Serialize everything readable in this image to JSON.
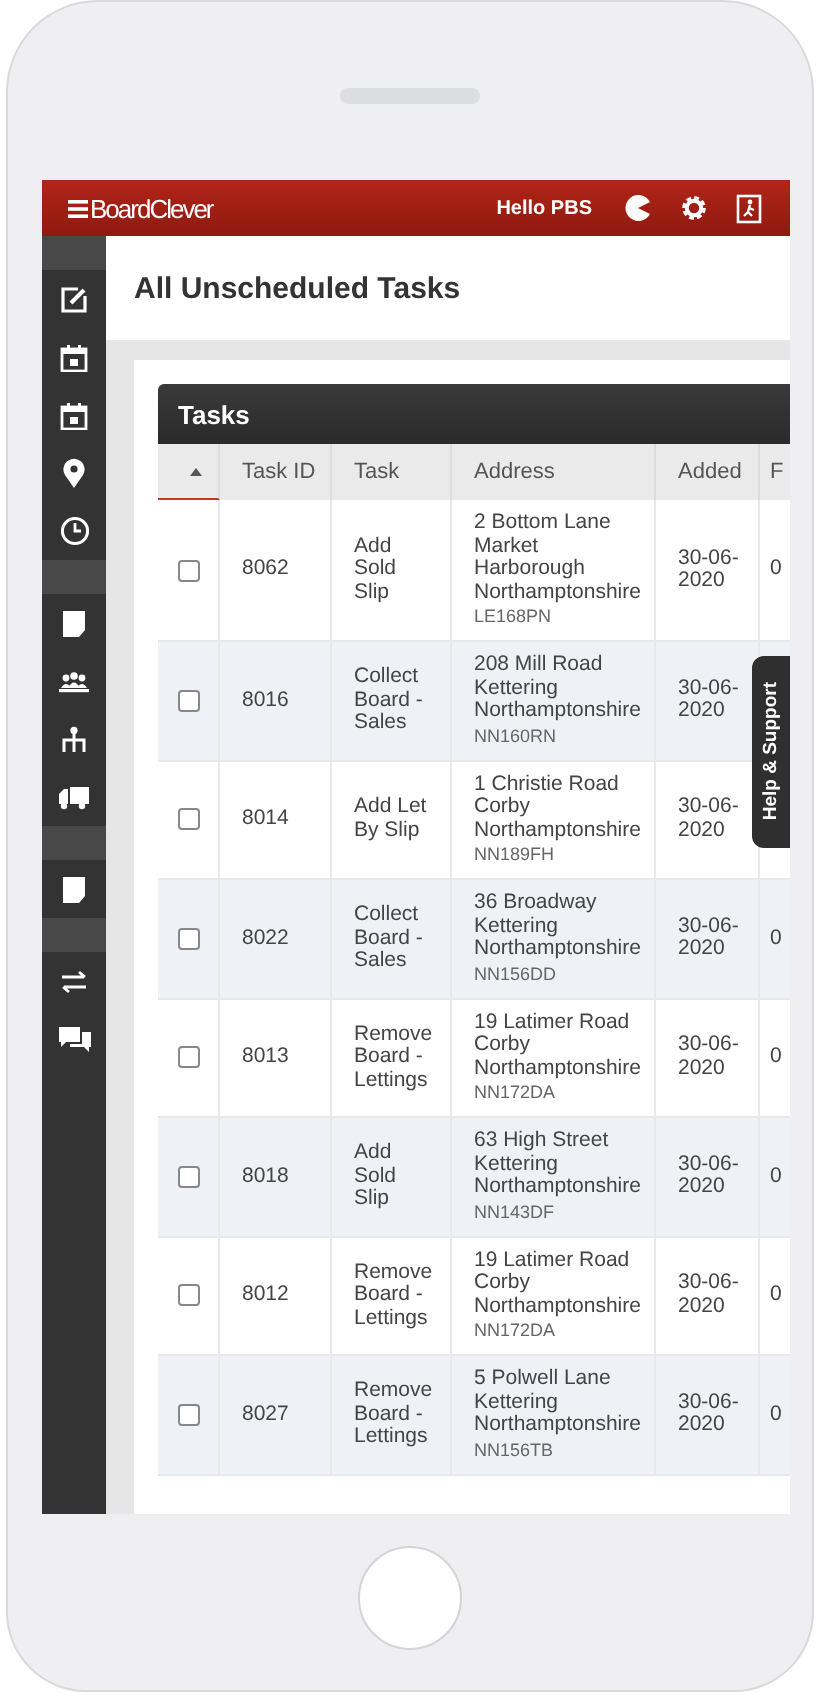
{
  "header": {
    "logo": "BoardClever",
    "greeting": "Hello PBS"
  },
  "page_title": "All Unscheduled Tasks",
  "panel": {
    "title": "Tasks",
    "columns": [
      "Task ID",
      "Task",
      "Address",
      "Added",
      "F"
    ],
    "rows": [
      {
        "checked": false,
        "task_id": "8062",
        "task": "Add\nSold\nSlip",
        "address": "2 Bottom Lane\nMarket\nHarborough\nNorthamptonshire",
        "postcode": "LE168PN",
        "added": "30-06-\n2020",
        "column_6": "0"
      },
      {
        "checked": false,
        "task_id": "8016",
        "task": "Collect\nBoard -\nSales",
        "address": "208 Mill Road\nKettering\nNorthamptonshire",
        "postcode": "NN160RN",
        "added": "30-06-\n2020"
      },
      {
        "checked": false,
        "task_id": "8014",
        "task": "Add Let\nBy Slip",
        "address": "1 Christie Road\nCorby\nNorthamptonshire",
        "postcode": "NN189FH",
        "added": "30-06-\n2020"
      },
      {
        "checked": false,
        "task_id": "8022",
        "task": "Collect\nBoard -\nSales",
        "address": "36 Broadway\nKettering\nNorthamptonshire",
        "postcode": "NN156DD",
        "added": "30-06-\n2020",
        "column_6": "0"
      },
      {
        "checked": false,
        "task_id": "8013",
        "task": "Remove\nBoard -\nLettings",
        "address": "19 Latimer Road\nCorby\nNorthamptonshire",
        "postcode": "NN172DA",
        "added": "30-06-\n2020",
        "column_6": "0"
      },
      {
        "checked": false,
        "task_id": "8018",
        "task": "Add\nSold\nSlip",
        "address": "63 High Street\nKettering\nNorthamptonshire",
        "postcode": "NN143DF",
        "added": "30-06-\n2020",
        "column_6": "0"
      },
      {
        "checked": false,
        "task_id": "8012",
        "task": "Remove\nBoard -\nLettings",
        "address": "19 Latimer Road\nCorby\nNorthamptonshire",
        "postcode": "NN172DA",
        "added": "30-06-\n2020",
        "column_6": "0"
      },
      {
        "checked": false,
        "task_id": "8027",
        "task": "Remove\nBoard -\nLettings",
        "address": "5 Polwell Lane\nKettering\nNorthamptonshire",
        "postcode": "NN156TB",
        "added": "30-06-\n2020",
        "column_6": "0"
      }
    ]
  },
  "help_tab": "Help & Support"
}
